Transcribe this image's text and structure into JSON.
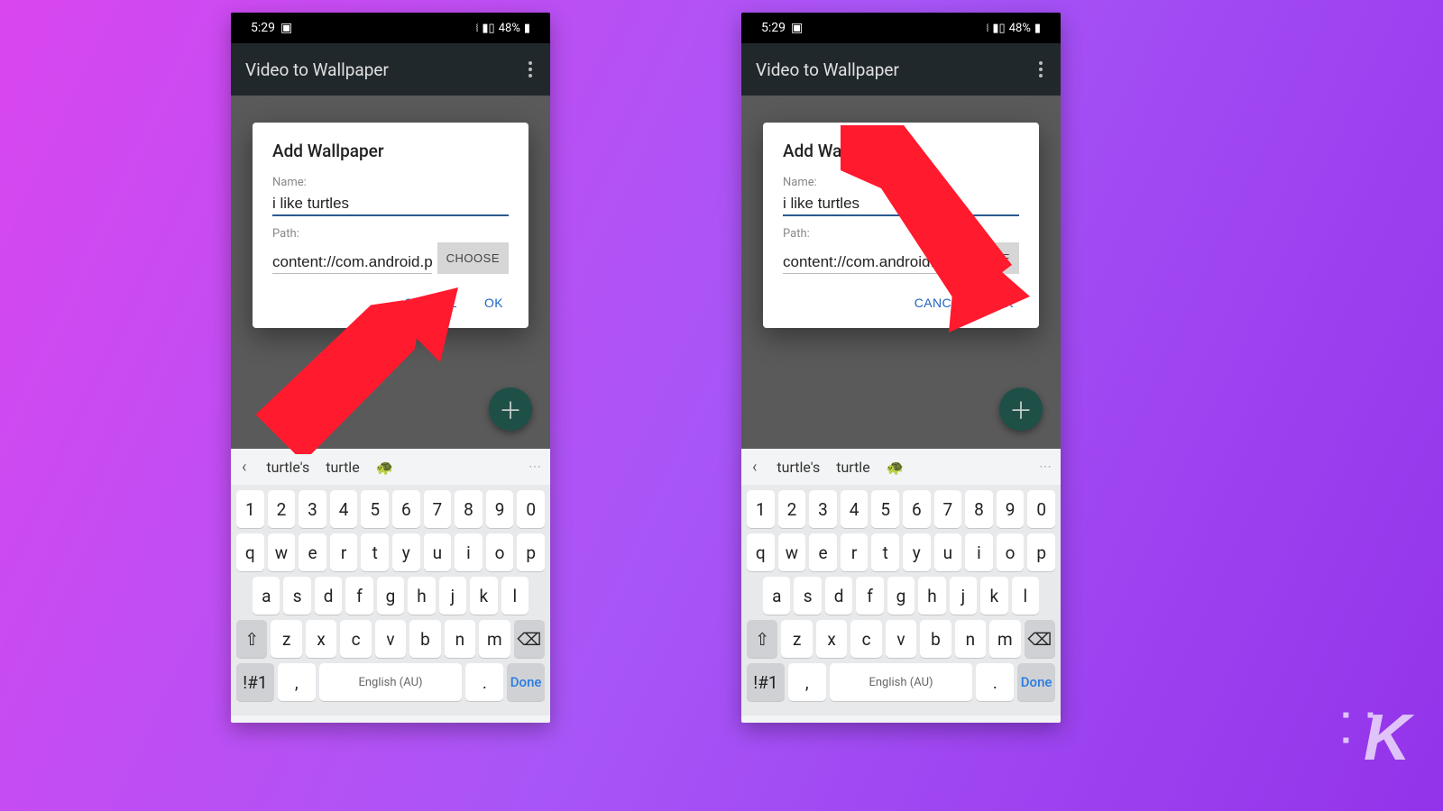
{
  "status": {
    "time": "5:29",
    "battery": "48%"
  },
  "app": {
    "title": "Video to Wallpaper"
  },
  "dialog": {
    "title": "Add Wallpaper",
    "name_label": "Name:",
    "name_value": "i like turtles",
    "path_label": "Path:",
    "path_value_left": "content://com.android.pr",
    "path_value_right": "content://com.android.",
    "choose": "CHOOSE",
    "cancel": "CANCEL",
    "ok": "OK"
  },
  "suggestions": {
    "s1": "turtle's",
    "s2": "turtle",
    "emoji": "🐢"
  },
  "keyboard": {
    "row1": [
      "1",
      "2",
      "3",
      "4",
      "5",
      "6",
      "7",
      "8",
      "9",
      "0"
    ],
    "row2": [
      "q",
      "w",
      "e",
      "r",
      "t",
      "y",
      "u",
      "i",
      "o",
      "p"
    ],
    "row3": [
      "a",
      "s",
      "d",
      "f",
      "g",
      "h",
      "j",
      "k",
      "l"
    ],
    "row4": [
      "z",
      "x",
      "c",
      "v",
      "b",
      "n",
      "m"
    ],
    "shift": "⇧",
    "backspace": "⌫",
    "symbols": "!#1",
    "comma": ",",
    "space": "English (AU)",
    "period": ".",
    "done": "Done"
  },
  "watermark": "K"
}
